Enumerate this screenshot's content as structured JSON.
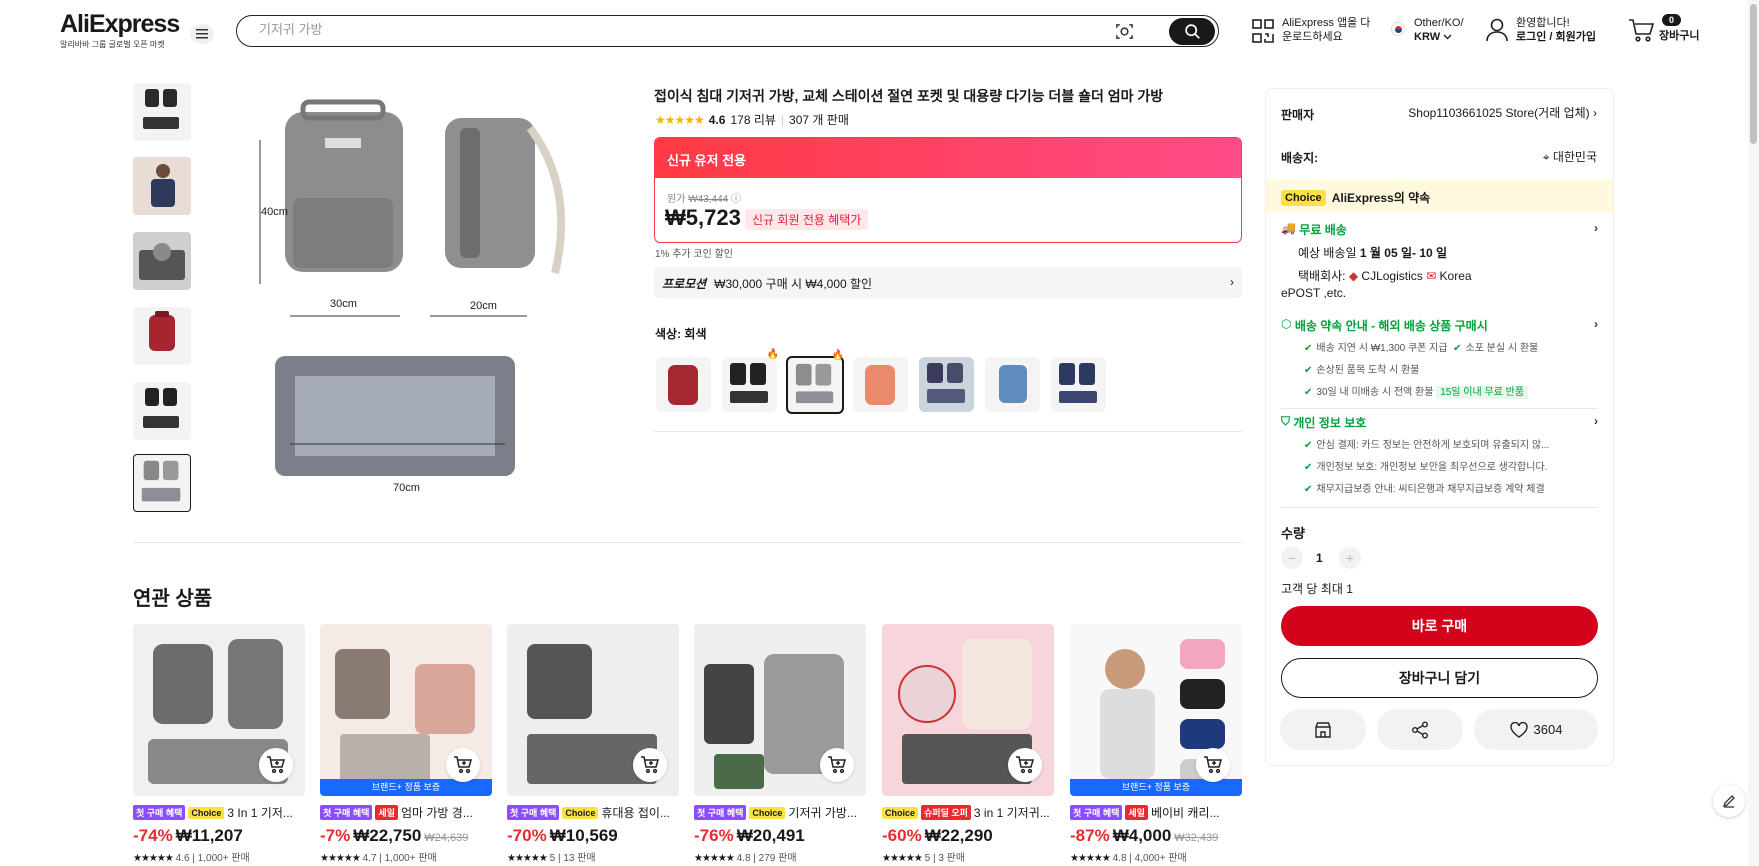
{
  "header": {
    "logo": "AliExpress",
    "logo_sub": "알리바바 그룹 글로벌 오픈 마켓",
    "search_placeholder": "기저귀 가방",
    "app_line1": "AliExpress 앱을 다",
    "app_line2": "운로드하세요",
    "region_line1": "Other/KO/",
    "region_line2": "KRW",
    "welcome": "환영합니다!",
    "login": "로그인 / 회원가입",
    "cart_count": "0",
    "cart_label": "장바구니"
  },
  "gallery": {
    "dim_height": "40cm",
    "dim_width": "30cm",
    "dim_depth": "20cm",
    "dim_bed": "70cm"
  },
  "product": {
    "title": "접이식 침대 기저귀 가방, 교체 스테이션 절연 포켓 및 대용량 다기능 더블 숄더 엄마 가방",
    "rating": "4.6",
    "reviews": "178 리뷰",
    "sold": "307 개 판매",
    "banner": "신규 유저 전용",
    "orig_label": "원가",
    "orig_price": "₩43,444",
    "price": "₩5,723",
    "new_tag": "신규 회원 전용 혜택가",
    "coin": "1% 추가 코인 할인",
    "promo_label": "프로모션",
    "promo_text": "₩30,000 구매 시 ₩4,000 할인",
    "color_label": "색상: 회색"
  },
  "side": {
    "seller_label": "판매자",
    "seller_name": "Shop1103661025 Store(거래 업체)",
    "ship_to_label": "배송지:",
    "ship_to": "대한민국",
    "choice_badge": "Choice",
    "choice_text": "AliExpress의 약속",
    "free_ship": "무료 배송",
    "eta_prefix": "예상 배송일",
    "eta": "1 월 05 일- 10 일",
    "courier_label": "택배회사:",
    "courier1": "CJLogistics",
    "courier2": "Korea",
    "courier3": "ePOST ,etc.",
    "promise_title": "배송 약속 안내 - 해외 배송 상품 구매시",
    "promise1": "배송 지연 시 ₩1,300 쿠폰 지급",
    "promise2": "소포 분실 시 환불",
    "promise3": "손상된 품목 도착 시 환불",
    "promise4": "30일 내 미배송 시 전액 환불",
    "promise4_tag": "15일 이내 무료 반품",
    "privacy_title": "개인 정보 보호",
    "privacy1": "안심 결제: 카드 정보는 안전하게 보호되며 유출되지 않...",
    "privacy2": "개인정보 보호: 개인정보 보안을 최우선으로 생각합니다.",
    "privacy3": "채무지급보증 안내: 씨티은행과 채무지급보증 계약 체결",
    "qty_label": "수량",
    "qty": "1",
    "max_per": "고객 당 최대 1",
    "buy_now": "바로 구매",
    "add_cart": "장바구니 담기",
    "wish_count": "3604"
  },
  "related": {
    "title": "연관 상품",
    "brand_bar": "브랜드+ 정품 보증",
    "items": [
      {
        "t1": "첫 구매 혜택",
        "t2": "Choice",
        "name": "3 In 1 기저...",
        "disc": "-74%",
        "price": "₩11,207",
        "orig": "",
        "rating": "4.6",
        "sold": "1,000+ 판매"
      },
      {
        "t1": "첫 구매 혜택",
        "t2": "세일",
        "name": "엄마 가방 경...",
        "disc": "-7%",
        "price": "₩22,750",
        "orig": "₩24,639",
        "rating": "4.7",
        "sold": "1,000+ 판매"
      },
      {
        "t1": "첫 구매 혜택",
        "t2": "Choice",
        "name": "휴대용 접이...",
        "disc": "-70%",
        "price": "₩10,569",
        "orig": "",
        "rating": "5",
        "sold": "13 판매"
      },
      {
        "t1": "첫 구매 혜택",
        "t2": "Choice",
        "name": "기저귀 가방...",
        "disc": "-76%",
        "price": "₩20,491",
        "orig": "",
        "rating": "4.8",
        "sold": "279 판매"
      },
      {
        "t1": "Choice",
        "t2": "슈퍼딜 오퍼",
        "name": "3 in 1 기저귀...",
        "disc": "-60%",
        "price": "₩22,290",
        "orig": "",
        "rating": "5",
        "sold": "3 판매"
      },
      {
        "t1": "첫 구매 혜택",
        "t2": "세일",
        "name": "베이비 캐리...",
        "disc": "-87%",
        "price": "₩4,000",
        "orig": "₩32,439",
        "rating": "4.8",
        "sold": "4,000+ 판매"
      }
    ]
  },
  "colors": {
    "accent": "#d3031c",
    "choice": "#fde144",
    "green": "#00a23b",
    "brand": "#1769ff"
  }
}
